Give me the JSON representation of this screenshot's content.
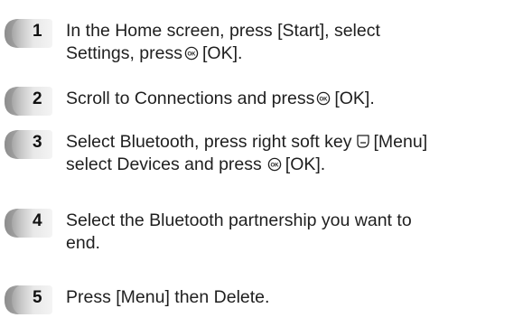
{
  "steps": [
    {
      "number": "1",
      "line1_a": "In the Home screen, press [Start], select",
      "line2_a": "Settings, press",
      "line2_b": "[OK].",
      "ok_icon": "ok-key-icon"
    },
    {
      "number": "2",
      "line1_a": "Scroll to Connections and press",
      "line1_b": "[OK].",
      "ok_icon": "ok-key-icon"
    },
    {
      "number": "3",
      "line1_a": "Select Bluetooth, press right soft key",
      "line1_b": "[Menu]",
      "line2_a": "select Devices and press",
      "line2_b": "[OK].",
      "softkey_icon": "right-soft-key-icon",
      "ok_icon": "ok-key-icon"
    },
    {
      "number": "4",
      "line1_a": "Select the Bluetooth partnership you want to",
      "line2_a": "end."
    },
    {
      "number": "5",
      "line1_a": "Press [Menu] then Delete."
    }
  ],
  "colors": {
    "badge_light": "#e6e6e6",
    "badge_dark": "#9a9a9a",
    "text": "#1f1f1f"
  }
}
